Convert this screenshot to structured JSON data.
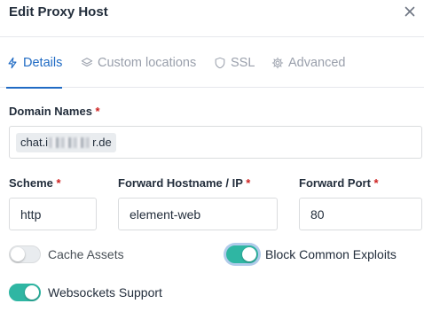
{
  "header": {
    "title": "Edit Proxy Host",
    "close_icon": "close-icon"
  },
  "tabs": [
    {
      "label": "Details",
      "icon": "bolt-icon",
      "active": true
    },
    {
      "label": "Custom locations",
      "icon": "layers-icon",
      "active": false
    },
    {
      "label": "SSL",
      "icon": "shield-icon",
      "active": false
    },
    {
      "label": "Advanced",
      "icon": "gear-icon",
      "active": false
    }
  ],
  "form": {
    "domain_names": {
      "label": "Domain Names",
      "required_mark": "*",
      "chip_prefix": "chat.i",
      "chip_suffix": "r.de"
    },
    "scheme": {
      "label": "Scheme",
      "required_mark": "*",
      "value": "http"
    },
    "forward_host": {
      "label": "Forward Hostname / IP",
      "required_mark": "*",
      "value": "element-web"
    },
    "forward_port": {
      "label": "Forward Port",
      "required_mark": "*",
      "value": "80"
    }
  },
  "toggles": {
    "cache_assets": {
      "label": "Cache Assets",
      "on": false
    },
    "block_exploits": {
      "label": "Block Common Exploits",
      "on": true
    },
    "websockets": {
      "label": "Websockets Support",
      "on": true
    }
  },
  "colors": {
    "accent": "#206bc4",
    "toggle_on": "#2fb6a3",
    "required": "#cd201f"
  }
}
